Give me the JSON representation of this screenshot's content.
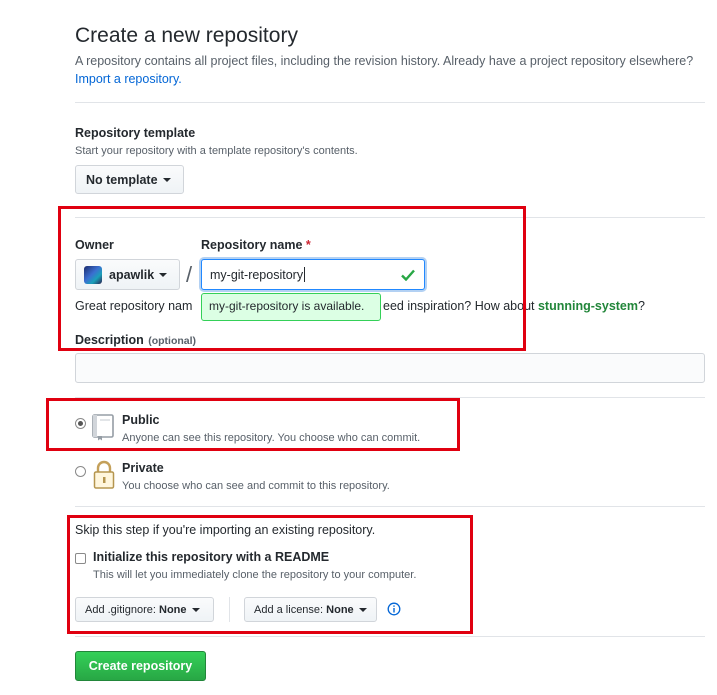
{
  "header": {
    "title": "Create a new repository",
    "intro_text": "A repository contains all project files, including the revision history. Already have a project repository elsewhere?",
    "import_link": "Import a repository."
  },
  "template": {
    "label": "Repository template",
    "note": "Start your repository with a template repository's contents.",
    "button": "No template"
  },
  "owner": {
    "label": "Owner",
    "value": "apawlik"
  },
  "repo_name": {
    "label": "Repository name",
    "required_mark": "*",
    "value": "my-git-repository",
    "available_tooltip": "my-git-repository is available."
  },
  "suggestion": {
    "prefix": "Great repository nam",
    "middle": "eed inspiration? How about",
    "suggested_name": "stunning-system",
    "suffix": "?"
  },
  "description": {
    "label": "Description",
    "optional": "(optional)",
    "value": ""
  },
  "visibility": {
    "public_label": "Public",
    "public_note": "Anyone can see this repository. You choose who can commit.",
    "private_label": "Private",
    "private_note": "You choose who can see and commit to this repository.",
    "selected": "public"
  },
  "init": {
    "skip_note": "Skip this step if you're importing an existing repository.",
    "readme_label": "Initialize this repository with a README",
    "readme_note": "This will let you immediately clone the repository to your computer.",
    "gitignore_prefix": "Add .gitignore:",
    "gitignore_value": "None",
    "license_prefix": "Add a license:",
    "license_value": "None",
    "info_icon": "info-icon"
  },
  "submit": {
    "label": "Create repository"
  },
  "colors": {
    "link": "#0366d6",
    "green": "#28a745",
    "highlight_box": "#e00010"
  }
}
